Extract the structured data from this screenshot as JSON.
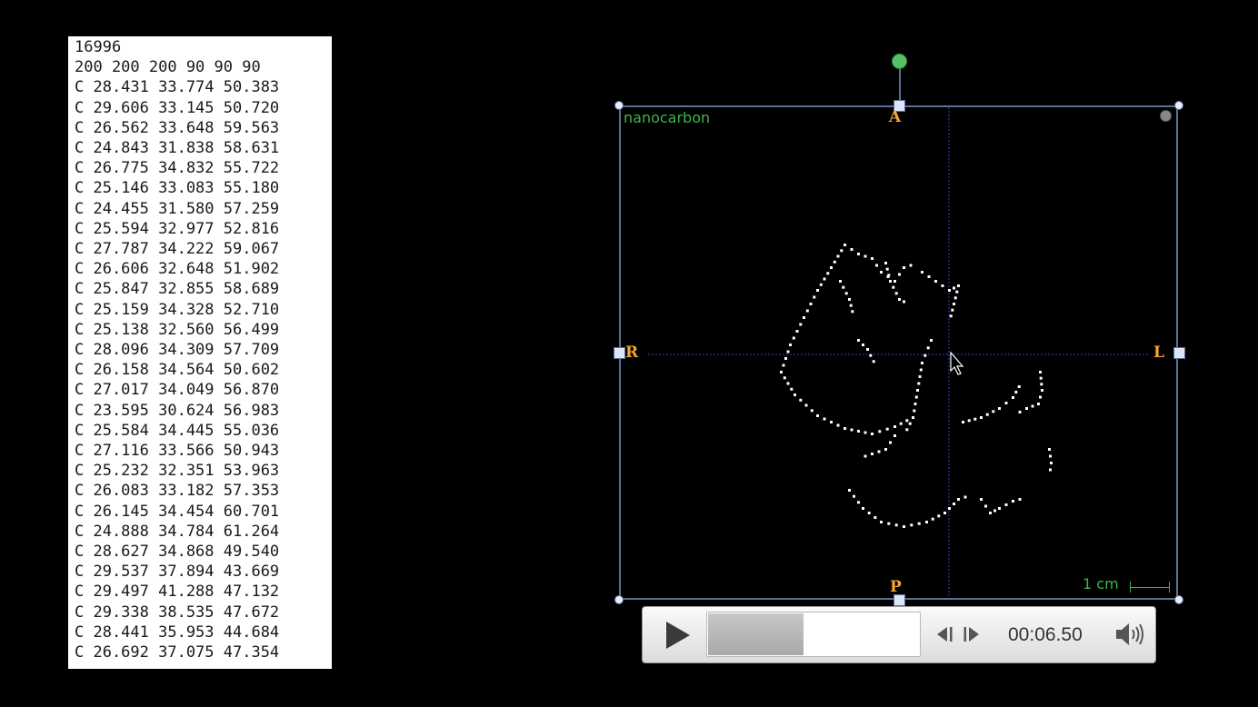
{
  "text_file": {
    "lines": [
      "16996",
      "200 200 200 90 90 90",
      "C 28.431 33.774 50.383",
      "C 29.606 33.145 50.720",
      "C 26.562 33.648 59.563",
      "C 24.843 31.838 58.631",
      "C 26.775 34.832 55.722",
      "C 25.146 33.083 55.180",
      "C 24.455 31.580 57.259",
      "C 25.594 32.977 52.816",
      "C 27.787 34.222 59.067",
      "C 26.606 32.648 51.902",
      "C 25.847 32.855 58.689",
      "C 25.159 34.328 52.710",
      "C 25.138 32.560 56.499",
      "C 28.096 34.309 57.709",
      "C 26.158 34.564 50.602",
      "C 27.017 34.049 56.870",
      "C 23.595 30.624 56.983",
      "C 25.584 34.445 55.036",
      "C 27.116 33.566 50.943",
      "C 25.232 32.351 53.963",
      "C 26.083 33.182 57.353",
      "C 26.145 34.454 60.701",
      "C 24.888 34.784 61.264",
      "C 28.627 34.868 49.540",
      "C 29.537 37.894 43.669",
      "C 29.497 41.288 47.132",
      "C 29.338 38.535 47.672",
      "C 28.441 35.953 44.684",
      "C 26.692 37.075 47.354"
    ]
  },
  "viewer": {
    "volume_label": "nanocarbon",
    "orientation": {
      "top": "A",
      "bottom": "P",
      "left": "R",
      "right": "L"
    },
    "scale_label": "1 cm",
    "accent_color": "#3db34a",
    "orientation_color": "#f3a72e"
  },
  "player": {
    "time": "00:06.50",
    "progress_fraction": 0.45,
    "play_icon": "play-icon",
    "step_back_icon": "step-back-icon",
    "step_forward_icon": "step-forward-icon",
    "volume_icon": "speaker-icon"
  }
}
